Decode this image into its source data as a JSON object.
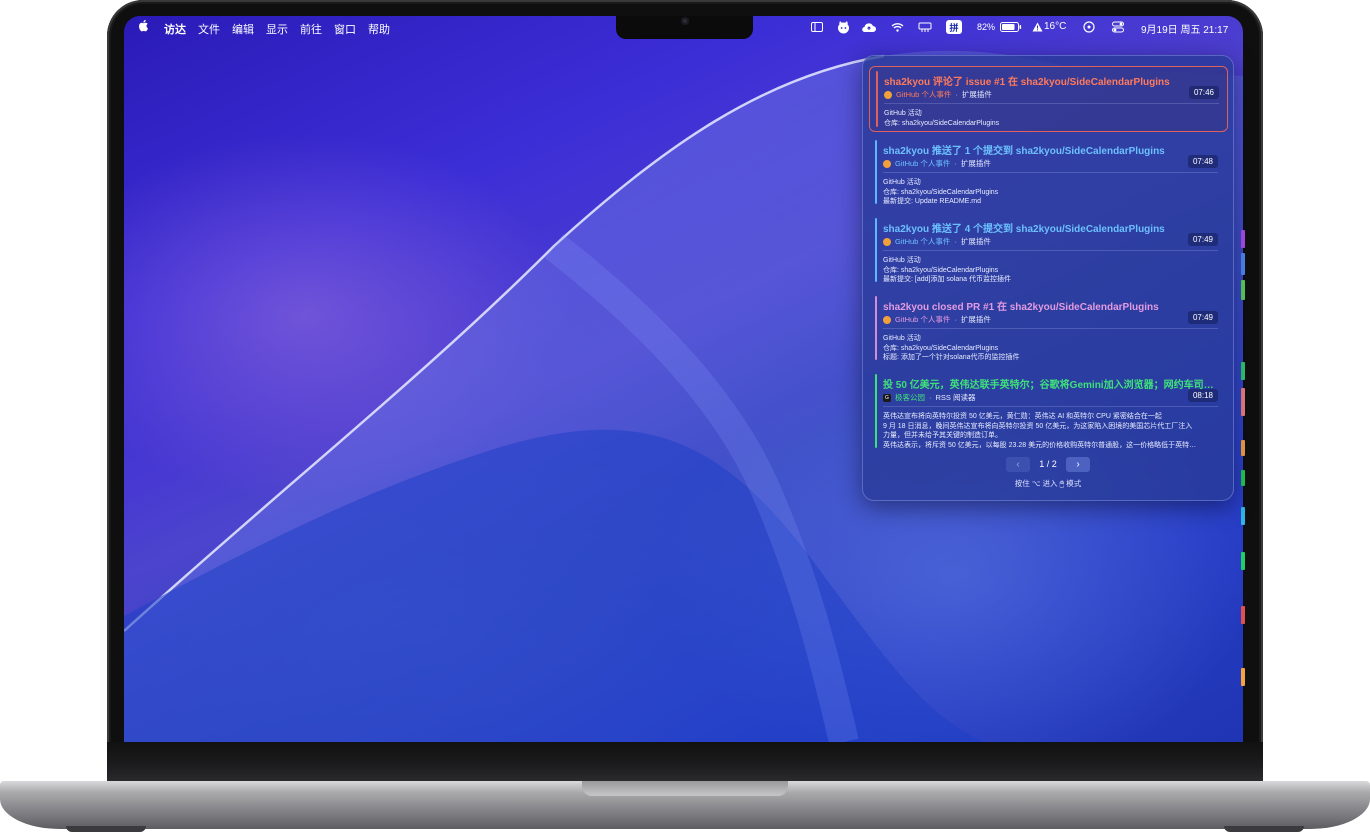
{
  "menubar": {
    "app_name": "访达",
    "menus": [
      "文件",
      "编辑",
      "显示",
      "前往",
      "窗口",
      "帮助"
    ],
    "battery": "82%",
    "weather": "16°C",
    "datetime": "9月19日 周五  21:17"
  },
  "panel": {
    "cards": [
      {
        "title": "sha2kyou 评论了 issue #1 在 sha2kyou/SideCalendarPlugins",
        "source": "GitHub 个人事件",
        "sep": "·",
        "category": "扩展插件",
        "time": "07:46",
        "lines": [
          "GitHub 活动",
          "仓库: sha2kyou/SideCalendarPlugins"
        ],
        "accent": "#ff6b5b"
      },
      {
        "title": "sha2kyou 推送了 1 个提交到 sha2kyou/SideCalendarPlugins",
        "source": "GitHub 个人事件",
        "sep": "·",
        "category": "扩展插件",
        "time": "07:48",
        "lines": [
          "GitHub 活动",
          "仓库: sha2kyou/SideCalendarPlugins",
          "最新提交: Update README.md"
        ],
        "accent": "#5cb8ff"
      },
      {
        "title": "sha2kyou 推送了 4 个提交到 sha2kyou/SideCalendarPlugins",
        "source": "GitHub 个人事件",
        "sep": "·",
        "category": "扩展插件",
        "time": "07:49",
        "lines": [
          "GitHub 活动",
          "仓库: sha2kyou/SideCalendarPlugins",
          "最新提交: [add]添加 solana 代币监控插件"
        ],
        "accent": "#5cb8ff"
      },
      {
        "title": "sha2kyou closed PR #1 在 sha2kyou/SideCalendarPlugins",
        "source": "GitHub 个人事件",
        "sep": "·",
        "category": "扩展插件",
        "time": "07:49",
        "lines": [
          "GitHub 活动",
          "仓库: sha2kyou/SideCalendarPlugins",
          "标题: 添加了一个针对solana代币的监控插件"
        ],
        "accent": "#d98ad6"
      },
      {
        "title": "投 50 亿美元，英伟达联手英特尔；谷歌将Gemini加入浏览器；网约车司机…",
        "source": "极客公园",
        "sep": "·",
        "category": "RSS 阅读器",
        "time": "08:18",
        "lines": [
          "英伟达宣布将向英特尔投资 50 亿美元，黄仁勋：英伟达 AI 和英特尔 CPU 紧密结合在一起",
          "9 月 18 日消息，晚间英伟达宣布将向英特尔投资 50 亿美元，为这家陷入困境的美国芯片代工厂注入",
          "力量，但并未给予其关键的制造订单。",
          "英伟达表示，将斥资 50 亿美元，以每股 23.28 美元的价格收购英特尔普通股，这一价格略低于英特…"
        ],
        "accent": "#3ee07a"
      }
    ],
    "pager": {
      "prev": "‹",
      "label": "1 / 2",
      "next": "›"
    },
    "hint": "按住 ⌥ 进入 🖱 模式"
  },
  "colors": {
    "strip": [
      "#b04df0",
      "#4d8cf5",
      "#5ad45a",
      "#2ecc71",
      "#f08080",
      "#f5a340",
      "#22cc55",
      "#2fb5e8",
      "#22cc66",
      "#e05050",
      "#f5a340"
    ]
  }
}
